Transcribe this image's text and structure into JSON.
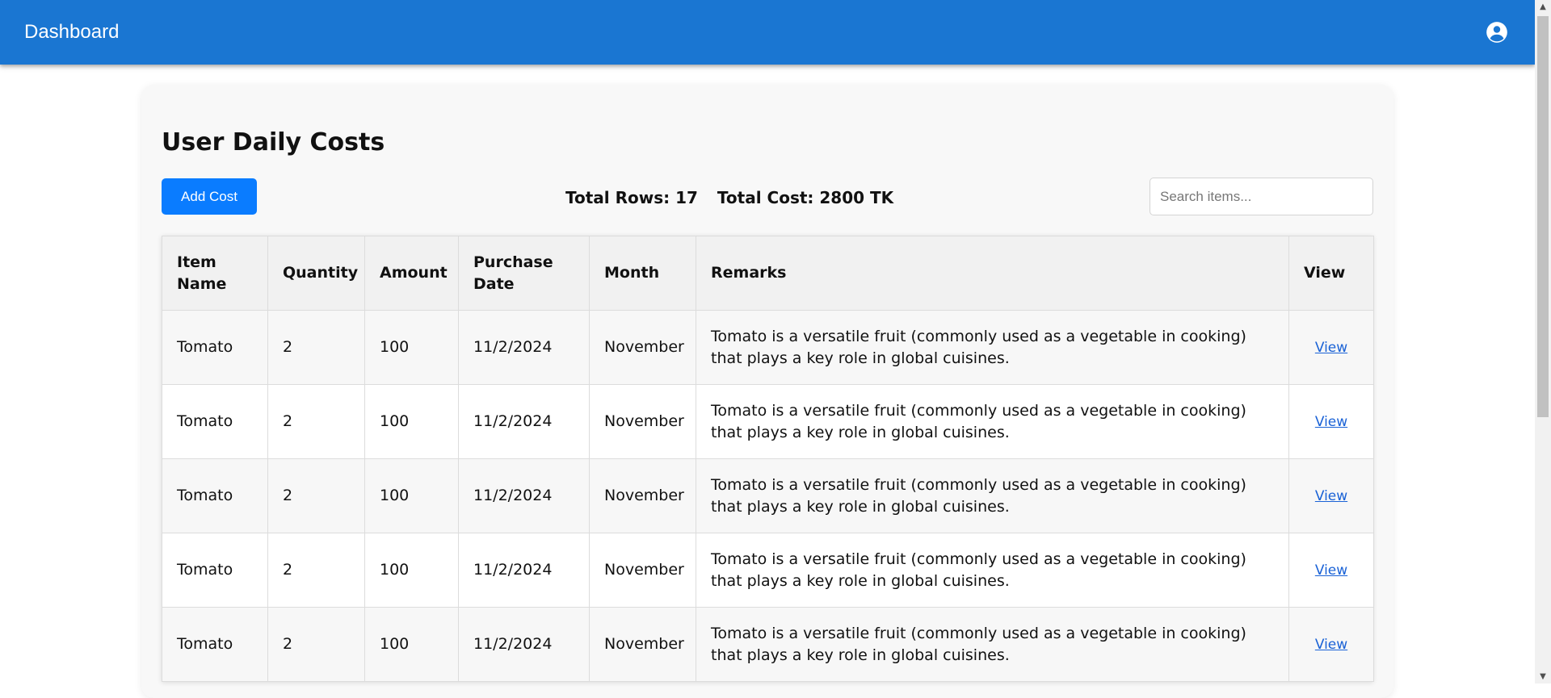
{
  "appbar": {
    "title": "Dashboard",
    "account_icon": "account-circle-icon"
  },
  "page": {
    "title": "User Daily Costs"
  },
  "toolbar": {
    "add_label": "Add Cost",
    "total_rows_text": "Total Rows: 17",
    "total_cost_text": "Total Cost: 2800 TK",
    "search_placeholder": "Search items..."
  },
  "table": {
    "headers": [
      "Item Name",
      "Quantity",
      "Amount",
      "Purchase Date",
      "Month",
      "Remarks",
      "View"
    ],
    "rows": [
      {
        "item": "Tomato",
        "quantity": "2",
        "amount": "100",
        "date": "11/2/2024",
        "month": "November",
        "remarks": "Tomato is a versatile fruit (commonly used as a vegetable in cooking) that plays a key role in global cuisines.",
        "view": "View"
      },
      {
        "item": "Tomato",
        "quantity": "2",
        "amount": "100",
        "date": "11/2/2024",
        "month": "November",
        "remarks": "Tomato is a versatile fruit (commonly used as a vegetable in cooking) that plays a key role in global cuisines.",
        "view": "View"
      },
      {
        "item": "Tomato",
        "quantity": "2",
        "amount": "100",
        "date": "11/2/2024",
        "month": "November",
        "remarks": "Tomato is a versatile fruit (commonly used as a vegetable in cooking) that plays a key role in global cuisines.",
        "view": "View"
      },
      {
        "item": "Tomato",
        "quantity": "2",
        "amount": "100",
        "date": "11/2/2024",
        "month": "November",
        "remarks": "Tomato is a versatile fruit (commonly used as a vegetable in cooking) that plays a key role in global cuisines.",
        "view": "View"
      },
      {
        "item": "Tomato",
        "quantity": "2",
        "amount": "100",
        "date": "11/2/2024",
        "month": "November",
        "remarks": "Tomato is a versatile fruit (commonly used as a vegetable in cooking) that plays a key role in global cuisines.",
        "view": "View"
      }
    ]
  },
  "colors": {
    "appbar": "#1a76d2",
    "primary_button": "#0a7cff",
    "link": "#1a62d6"
  }
}
